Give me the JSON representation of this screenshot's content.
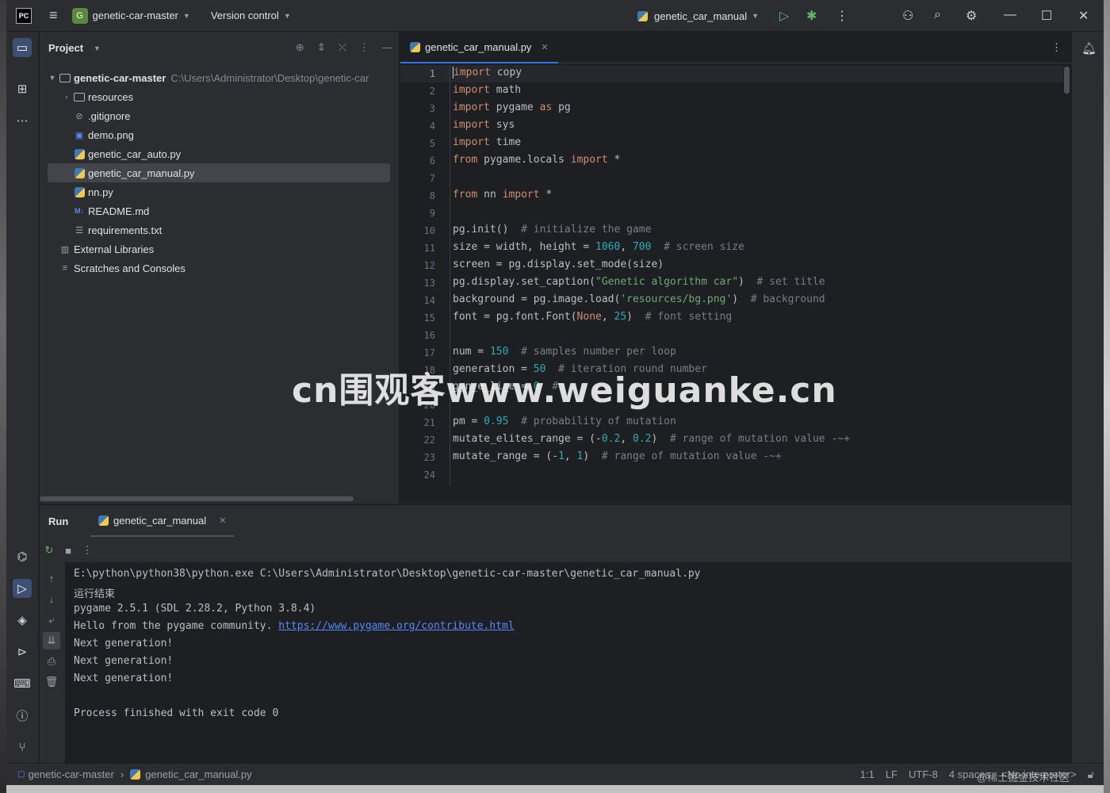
{
  "titlebar": {
    "app_logo": "PC",
    "project_badge": "G",
    "project_name": "genetic-car-master",
    "vcs_label": "Version control",
    "run_config": "genetic_car_manual"
  },
  "project_panel": {
    "title": "Project",
    "root_name": "genetic-car-master",
    "root_path": "C:\\Users\\Administrator\\Desktop\\genetic-car",
    "items": [
      {
        "label": "resources",
        "icon": "folder-icon"
      },
      {
        "label": ".gitignore",
        "icon": "ignore-file-icon"
      },
      {
        "label": "demo.png",
        "icon": "image-file-icon"
      },
      {
        "label": "genetic_car_auto.py",
        "icon": "python-file-icon"
      },
      {
        "label": "genetic_car_manual.py",
        "icon": "python-file-icon"
      },
      {
        "label": "nn.py",
        "icon": "python-file-icon"
      },
      {
        "label": "README.md",
        "icon": "markdown-file-icon"
      },
      {
        "label": "requirements.txt",
        "icon": "text-file-icon"
      }
    ],
    "external_libraries": "External Libraries",
    "scratches": "Scratches and Consoles"
  },
  "editor": {
    "tab_label": "genetic_car_manual.py",
    "current_line": 1,
    "line_numbers": [
      "1",
      "2",
      "3",
      "4",
      "5",
      "6",
      "7",
      "8",
      "9",
      "10",
      "11",
      "12",
      "13",
      "14",
      "15",
      "16",
      "17",
      "18",
      "19",
      "20",
      "21",
      "22",
      "23",
      "24"
    ]
  },
  "run_panel": {
    "title": "Run",
    "tab_label": "genetic_car_manual",
    "console_lines": [
      "E:\\python\\python38\\python.exe C:\\Users\\Administrator\\Desktop\\genetic-car-master\\genetic_car_manual.py",
      "运行结束",
      "pygame 2.5.1 (SDL 2.28.2, Python 3.8.4)",
      "Hello from the pygame community. ",
      "Next generation!",
      "Next generation!",
      "Next generation!",
      "",
      "Process finished with exit code 0"
    ],
    "console_link": "https://www.pygame.org/contribute.html"
  },
  "statusbar": {
    "breadcrumb_project": "genetic-car-master",
    "breadcrumb_file": "genetic_car_manual.py",
    "position": "1:1",
    "line_sep": "LF",
    "encoding": "UTF-8",
    "indent": "4 spaces",
    "interpreter": "<No interpreter>"
  },
  "watermark": "cn围观客www.weiguanke.cn",
  "corner_watermark": "@稀土掘金技术社区",
  "colors": {
    "accent": "#3574f0",
    "keyword": "#cf8e6d",
    "number": "#2aacb8",
    "string": "#6aab73",
    "comment": "#7a7e85"
  }
}
